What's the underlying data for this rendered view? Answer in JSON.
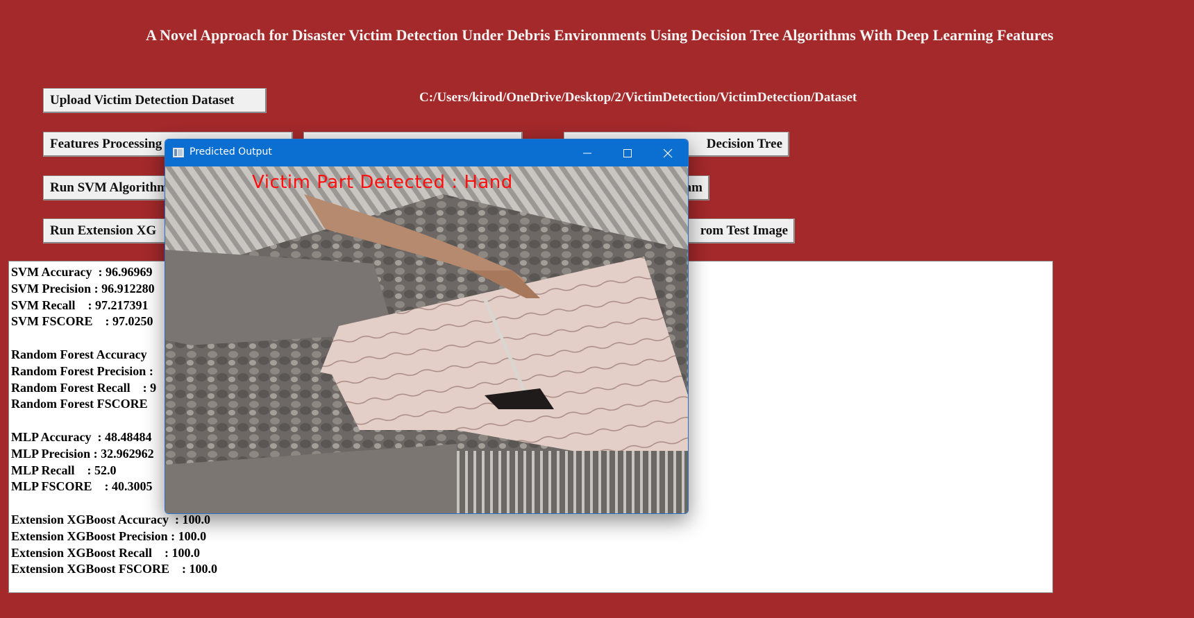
{
  "app": {
    "title": "A Novel Approach for Disaster Victim Detection Under Debris Environments Using Decision Tree Algorithms With Deep Learning Features"
  },
  "buttons": {
    "upload": "Upload Victim Detection Dataset",
    "features": "Features Processing",
    "decision_tree": "Decision Tree",
    "svm": "Run SVM Algorithm",
    "graph": "am",
    "xgboost": "Run Extension XG",
    "test_image": "rom Test Image"
  },
  "dataset_path": "C:/Users/kirod/OneDrive/Desktop/2/VictimDetection/VictimDetection/Dataset",
  "output": {
    "lines": [
      "SVM Accuracy  : 96.96969",
      "SVM Precision : 96.912280",
      "SVM Recall    : 97.217391",
      "SVM FSCORE    : 97.0250",
      "",
      "Random Forest Accuracy",
      "Random Forest Precision :",
      "Random Forest Recall    : 9",
      "Random Forest FSCORE",
      "",
      "MLP Accuracy  : 48.48484",
      "MLP Precision : 32.962962",
      "MLP Recall    : 52.0",
      "MLP FSCORE    : 40.3005",
      "",
      "Extension XGBoost Accuracy  : 100.0",
      "Extension XGBoost Precision : 100.0",
      "Extension XGBoost Recall    : 100.0",
      "Extension XGBoost FSCORE    : 100.0"
    ]
  },
  "popup": {
    "title": "Predicted Output",
    "overlay_text": "Victim Part Detected : Hand",
    "icons": {
      "app": "window-app-icon",
      "minimize": "minimize-icon",
      "maximize": "maximize-icon",
      "close": "close-icon"
    }
  },
  "colors": {
    "background": "#a3292b",
    "titlebar": "#0a6fd1",
    "overlay_text": "#ff1010"
  }
}
